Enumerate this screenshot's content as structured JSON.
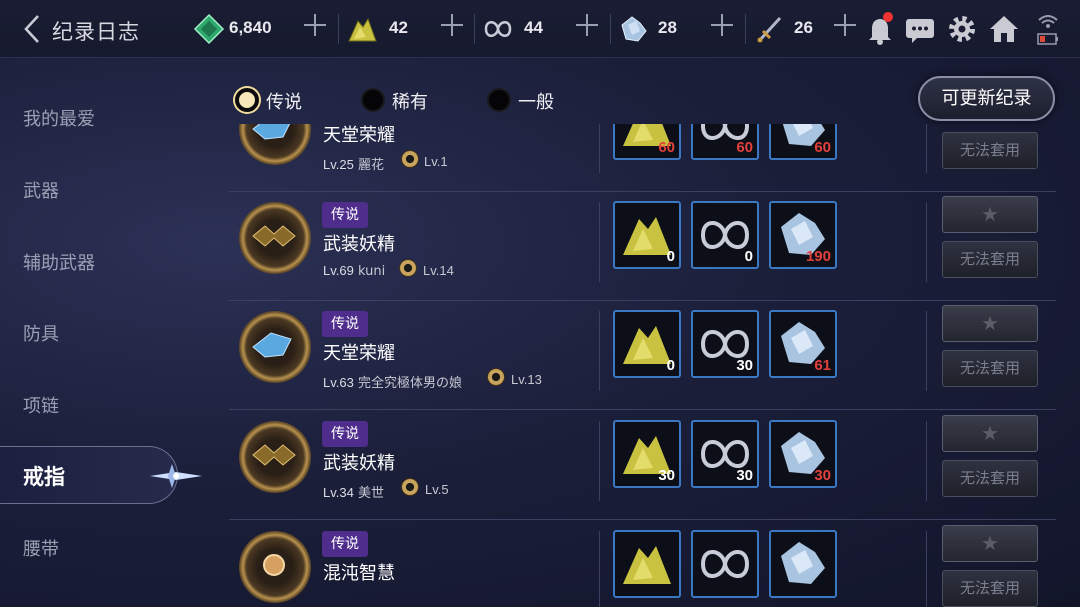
{
  "header": {
    "title": "纪录日志",
    "resources": [
      {
        "name": "diamond",
        "icon": "diamond-icon",
        "value": "6,840"
      },
      {
        "name": "gold-ore",
        "icon": "gold-ore-icon",
        "value": "42"
      },
      {
        "name": "silver-thread",
        "icon": "silver-thread-icon",
        "value": "44"
      },
      {
        "name": "crystal",
        "icon": "crystal-icon",
        "value": "28"
      },
      {
        "name": "dagger",
        "icon": "dagger-icon",
        "value": "26"
      }
    ]
  },
  "filters": [
    {
      "label": "传说",
      "selected": true
    },
    {
      "label": "稀有",
      "selected": false
    },
    {
      "label": "一般",
      "selected": false
    }
  ],
  "refresh_button": "可更新纪录",
  "sidebar": {
    "items": [
      "我的最爱",
      "武器",
      "辅助武器",
      "防具",
      "项链",
      "戒指",
      "腰带"
    ],
    "active": "戒指"
  },
  "rows": [
    {
      "badge": "",
      "name": "天堂荣耀",
      "owner_level": "Lv.25",
      "owner": "麗花",
      "gear_level": "Lv.1",
      "mats": [
        "60",
        "60",
        "60"
      ],
      "mat_low": [
        true,
        true,
        true
      ],
      "button": "无法套用"
    },
    {
      "badge": "传说",
      "name": "武装妖精",
      "owner_level": "Lv.69",
      "owner": "kuni",
      "gear_level": "Lv.14",
      "mats": [
        "0",
        "0",
        "190"
      ],
      "mat_low": [
        false,
        false,
        true
      ],
      "button": "无法套用"
    },
    {
      "badge": "传说",
      "name": "天堂荣耀",
      "owner_level": "Lv.63",
      "owner": "完全究極体男の娘",
      "gear_level": "Lv.13",
      "mats": [
        "0",
        "30",
        "61"
      ],
      "mat_low": [
        false,
        false,
        true
      ],
      "button": "无法套用"
    },
    {
      "badge": "传说",
      "name": "武装妖精",
      "owner_level": "Lv.34",
      "owner": "美世",
      "gear_level": "Lv.5",
      "mats": [
        "30",
        "30",
        "30"
      ],
      "mat_low": [
        false,
        false,
        true
      ],
      "button": "无法套用"
    },
    {
      "badge": "传说",
      "name": "混沌智慧",
      "owner_level": "",
      "owner": "",
      "gear_level": "",
      "mats": [
        "",
        "",
        ""
      ],
      "mat_low": [
        false,
        false,
        false
      ],
      "button": "无法套用"
    }
  ],
  "colors": {
    "badge": "#4f2d8d",
    "mat_border": "#3a78c4",
    "low_count": "#e2403a",
    "notification": "#e33333"
  }
}
